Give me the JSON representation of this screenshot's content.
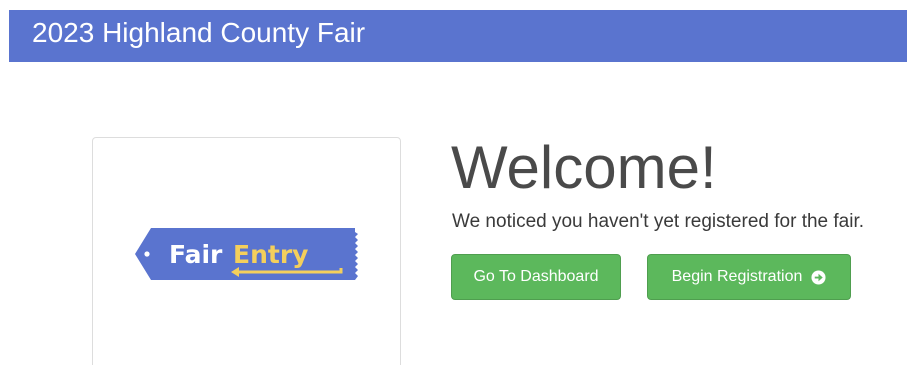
{
  "header": {
    "title": "2023 Highland County Fair",
    "background_color": "#5a74cf"
  },
  "logo": {
    "word_fair": "Fair",
    "word_entry": "Entry",
    "tag_color": "#5a74cf",
    "accent_color": "#f4cf5c",
    "icon": "fairentry-tag-logo"
  },
  "main": {
    "heading": "Welcome!",
    "message": "We noticed you haven't yet registered for the fair.",
    "buttons": {
      "dashboard_label": "Go To Dashboard",
      "register_label": "Begin Registration",
      "register_icon": "circle-arrow-right-icon",
      "color": "#5cb85c"
    }
  }
}
